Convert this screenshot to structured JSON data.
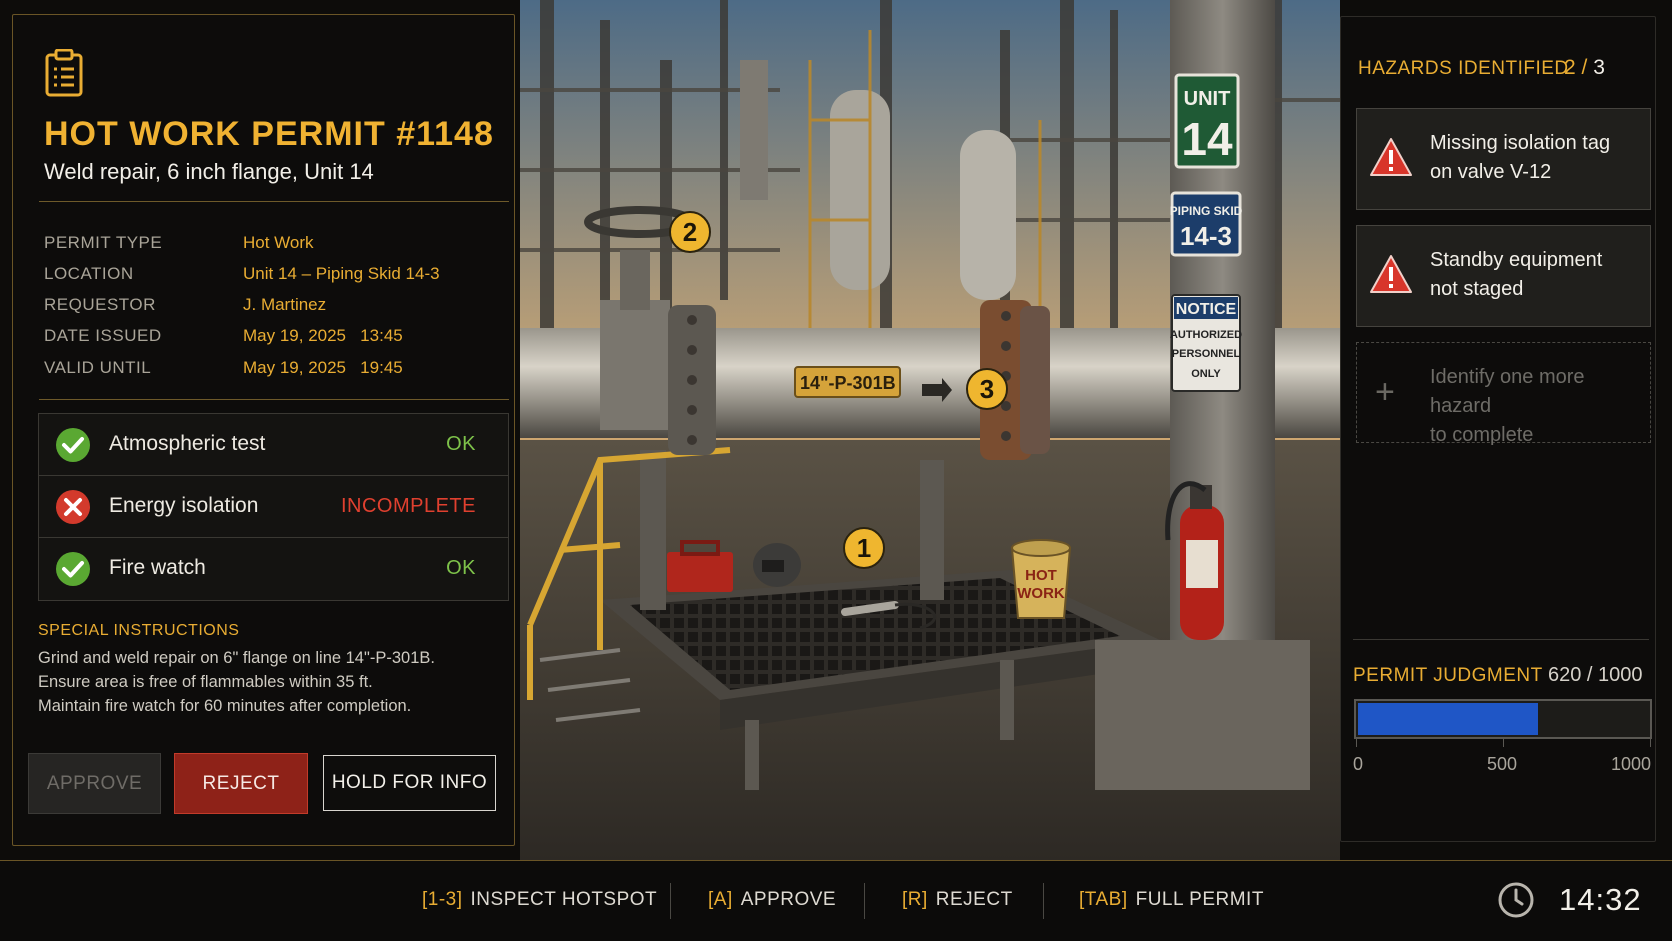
{
  "permit": {
    "title": "HOT WORK PERMIT #1148",
    "subtitle": "Weld repair, 6 inch flange, Unit 14",
    "fields": [
      {
        "label": "PERMIT TYPE",
        "value": "Hot Work"
      },
      {
        "label": "LOCATION",
        "value": "Unit 14 – Piping Skid 14-3"
      },
      {
        "label": "REQUESTOR",
        "value": "J. Martinez"
      },
      {
        "label": "DATE ISSUED",
        "value": "May 19, 2025   13:45"
      },
      {
        "label": "VALID UNTIL",
        "value": "May 19, 2025   19:45"
      }
    ],
    "checks": [
      {
        "label": "Atmospheric test",
        "status": "OK",
        "state": "ok"
      },
      {
        "label": "Energy isolation",
        "status": "INCOMPLETE",
        "state": "fail"
      },
      {
        "label": "Fire watch",
        "status": "OK",
        "state": "ok"
      }
    ],
    "special_title": "SPECIAL INSTRUCTIONS",
    "special_lines": [
      "Grind and weld repair on 6\" flange on line 14\"-P-301B.",
      "Ensure area is free of flammables within 35 ft.",
      "Maintain fire watch for 60 minutes after completion."
    ],
    "buttons": {
      "approve": "APPROVE",
      "reject": "REJECT",
      "hold": "HOLD FOR INFO"
    }
  },
  "hazards": {
    "title": "HAZARDS IDENTIFIED",
    "found": "2",
    "separator": " / ",
    "total": "3",
    "items": [
      {
        "line1": "Missing isolation tag",
        "line2": "on valve V-12"
      },
      {
        "line1": "Standby equipment",
        "line2": "not staged"
      }
    ],
    "empty": {
      "line1": "Identify one more hazard",
      "line2": "to complete"
    }
  },
  "judgment": {
    "title": "PERMIT JUDGMENT",
    "score_text": "620 / 1000",
    "value": 620,
    "max": 1000,
    "ticks": [
      "0",
      "500",
      "1000"
    ]
  },
  "scene": {
    "sign_unit_top": "UNIT",
    "sign_unit_num": "14",
    "sign_skid_top": "PIPING SKID",
    "sign_skid_num": "14-3",
    "sign_notice_top": "NOTICE",
    "sign_notice_l1": "AUTHORIZED",
    "sign_notice_l2": "PERSONNEL",
    "sign_notice_l3": "ONLY",
    "pipe_label": "14\"-P-301B",
    "bucket_l1": "HOT",
    "bucket_l2": "WORK",
    "hotspots": [
      "1",
      "2",
      "3"
    ]
  },
  "bottom": {
    "hints": [
      {
        "key": "[1-3]",
        "text": "INSPECT HOTSPOT"
      },
      {
        "key": "[A]",
        "text": "APPROVE"
      },
      {
        "key": "[R]",
        "text": "REJECT"
      },
      {
        "key": "[TAB]",
        "text": "FULL PERMIT"
      }
    ],
    "clock": "14:32"
  },
  "colors": {
    "accent": "#e9ad33",
    "ok": "#5aa832",
    "fail": "#d33a2c",
    "bar": "#1f56c6"
  }
}
